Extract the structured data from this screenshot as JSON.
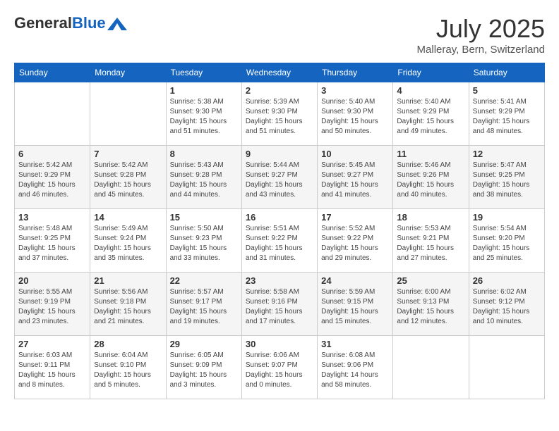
{
  "header": {
    "logo_general": "General",
    "logo_blue": "Blue",
    "month_title": "July 2025",
    "location": "Malleray, Bern, Switzerland"
  },
  "weekdays": [
    "Sunday",
    "Monday",
    "Tuesday",
    "Wednesday",
    "Thursday",
    "Friday",
    "Saturday"
  ],
  "weeks": [
    [
      {
        "day": "",
        "sunrise": "",
        "sunset": "",
        "daylight": ""
      },
      {
        "day": "",
        "sunrise": "",
        "sunset": "",
        "daylight": ""
      },
      {
        "day": "1",
        "sunrise": "Sunrise: 5:38 AM",
        "sunset": "Sunset: 9:30 PM",
        "daylight": "Daylight: 15 hours and 51 minutes."
      },
      {
        "day": "2",
        "sunrise": "Sunrise: 5:39 AM",
        "sunset": "Sunset: 9:30 PM",
        "daylight": "Daylight: 15 hours and 51 minutes."
      },
      {
        "day": "3",
        "sunrise": "Sunrise: 5:40 AM",
        "sunset": "Sunset: 9:30 PM",
        "daylight": "Daylight: 15 hours and 50 minutes."
      },
      {
        "day": "4",
        "sunrise": "Sunrise: 5:40 AM",
        "sunset": "Sunset: 9:29 PM",
        "daylight": "Daylight: 15 hours and 49 minutes."
      },
      {
        "day": "5",
        "sunrise": "Sunrise: 5:41 AM",
        "sunset": "Sunset: 9:29 PM",
        "daylight": "Daylight: 15 hours and 48 minutes."
      }
    ],
    [
      {
        "day": "6",
        "sunrise": "Sunrise: 5:42 AM",
        "sunset": "Sunset: 9:29 PM",
        "daylight": "Daylight: 15 hours and 46 minutes."
      },
      {
        "day": "7",
        "sunrise": "Sunrise: 5:42 AM",
        "sunset": "Sunset: 9:28 PM",
        "daylight": "Daylight: 15 hours and 45 minutes."
      },
      {
        "day": "8",
        "sunrise": "Sunrise: 5:43 AM",
        "sunset": "Sunset: 9:28 PM",
        "daylight": "Daylight: 15 hours and 44 minutes."
      },
      {
        "day": "9",
        "sunrise": "Sunrise: 5:44 AM",
        "sunset": "Sunset: 9:27 PM",
        "daylight": "Daylight: 15 hours and 43 minutes."
      },
      {
        "day": "10",
        "sunrise": "Sunrise: 5:45 AM",
        "sunset": "Sunset: 9:27 PM",
        "daylight": "Daylight: 15 hours and 41 minutes."
      },
      {
        "day": "11",
        "sunrise": "Sunrise: 5:46 AM",
        "sunset": "Sunset: 9:26 PM",
        "daylight": "Daylight: 15 hours and 40 minutes."
      },
      {
        "day": "12",
        "sunrise": "Sunrise: 5:47 AM",
        "sunset": "Sunset: 9:25 PM",
        "daylight": "Daylight: 15 hours and 38 minutes."
      }
    ],
    [
      {
        "day": "13",
        "sunrise": "Sunrise: 5:48 AM",
        "sunset": "Sunset: 9:25 PM",
        "daylight": "Daylight: 15 hours and 37 minutes."
      },
      {
        "day": "14",
        "sunrise": "Sunrise: 5:49 AM",
        "sunset": "Sunset: 9:24 PM",
        "daylight": "Daylight: 15 hours and 35 minutes."
      },
      {
        "day": "15",
        "sunrise": "Sunrise: 5:50 AM",
        "sunset": "Sunset: 9:23 PM",
        "daylight": "Daylight: 15 hours and 33 minutes."
      },
      {
        "day": "16",
        "sunrise": "Sunrise: 5:51 AM",
        "sunset": "Sunset: 9:22 PM",
        "daylight": "Daylight: 15 hours and 31 minutes."
      },
      {
        "day": "17",
        "sunrise": "Sunrise: 5:52 AM",
        "sunset": "Sunset: 9:22 PM",
        "daylight": "Daylight: 15 hours and 29 minutes."
      },
      {
        "day": "18",
        "sunrise": "Sunrise: 5:53 AM",
        "sunset": "Sunset: 9:21 PM",
        "daylight": "Daylight: 15 hours and 27 minutes."
      },
      {
        "day": "19",
        "sunrise": "Sunrise: 5:54 AM",
        "sunset": "Sunset: 9:20 PM",
        "daylight": "Daylight: 15 hours and 25 minutes."
      }
    ],
    [
      {
        "day": "20",
        "sunrise": "Sunrise: 5:55 AM",
        "sunset": "Sunset: 9:19 PM",
        "daylight": "Daylight: 15 hours and 23 minutes."
      },
      {
        "day": "21",
        "sunrise": "Sunrise: 5:56 AM",
        "sunset": "Sunset: 9:18 PM",
        "daylight": "Daylight: 15 hours and 21 minutes."
      },
      {
        "day": "22",
        "sunrise": "Sunrise: 5:57 AM",
        "sunset": "Sunset: 9:17 PM",
        "daylight": "Daylight: 15 hours and 19 minutes."
      },
      {
        "day": "23",
        "sunrise": "Sunrise: 5:58 AM",
        "sunset": "Sunset: 9:16 PM",
        "daylight": "Daylight: 15 hours and 17 minutes."
      },
      {
        "day": "24",
        "sunrise": "Sunrise: 5:59 AM",
        "sunset": "Sunset: 9:15 PM",
        "daylight": "Daylight: 15 hours and 15 minutes."
      },
      {
        "day": "25",
        "sunrise": "Sunrise: 6:00 AM",
        "sunset": "Sunset: 9:13 PM",
        "daylight": "Daylight: 15 hours and 12 minutes."
      },
      {
        "day": "26",
        "sunrise": "Sunrise: 6:02 AM",
        "sunset": "Sunset: 9:12 PM",
        "daylight": "Daylight: 15 hours and 10 minutes."
      }
    ],
    [
      {
        "day": "27",
        "sunrise": "Sunrise: 6:03 AM",
        "sunset": "Sunset: 9:11 PM",
        "daylight": "Daylight: 15 hours and 8 minutes."
      },
      {
        "day": "28",
        "sunrise": "Sunrise: 6:04 AM",
        "sunset": "Sunset: 9:10 PM",
        "daylight": "Daylight: 15 hours and 5 minutes."
      },
      {
        "day": "29",
        "sunrise": "Sunrise: 6:05 AM",
        "sunset": "Sunset: 9:09 PM",
        "daylight": "Daylight: 15 hours and 3 minutes."
      },
      {
        "day": "30",
        "sunrise": "Sunrise: 6:06 AM",
        "sunset": "Sunset: 9:07 PM",
        "daylight": "Daylight: 15 hours and 0 minutes."
      },
      {
        "day": "31",
        "sunrise": "Sunrise: 6:08 AM",
        "sunset": "Sunset: 9:06 PM",
        "daylight": "Daylight: 14 hours and 58 minutes."
      },
      {
        "day": "",
        "sunrise": "",
        "sunset": "",
        "daylight": ""
      },
      {
        "day": "",
        "sunrise": "",
        "sunset": "",
        "daylight": ""
      }
    ]
  ]
}
